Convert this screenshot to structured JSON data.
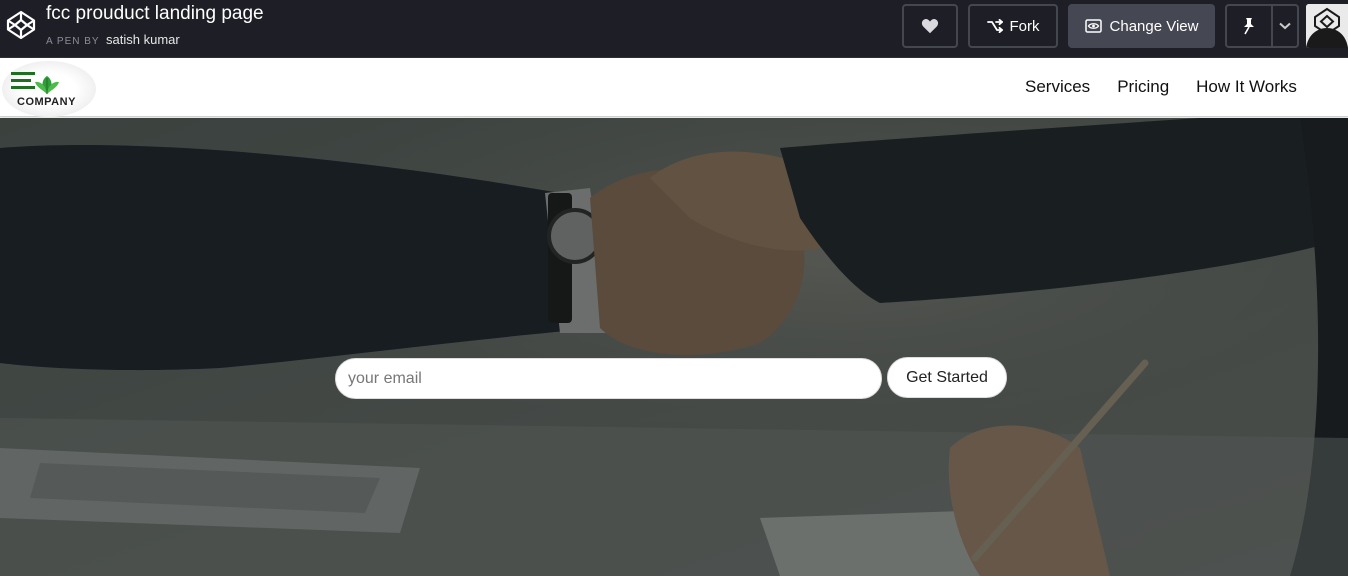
{
  "header": {
    "pen_title": "fcc prouduct landing page",
    "by_label": "A PEN BY",
    "author": "satish kumar",
    "fork_label": "Fork",
    "change_view_label": "Change View"
  },
  "icons": {
    "logo": "codepen-logo-icon",
    "heart": "heart-icon",
    "fork": "fork-icon",
    "view": "eye-icon",
    "pin": "pin-icon",
    "chevron": "chevron-down-icon"
  },
  "navbar": {
    "brand_text": "COMPANY",
    "links": [
      {
        "label": "Services"
      },
      {
        "label": "Pricing"
      },
      {
        "label": "How It Works"
      }
    ]
  },
  "hero": {
    "email_placeholder": "your email",
    "cta_label": "Get Started"
  },
  "colors": {
    "header_bg": "#1e1f26",
    "change_view_bg": "#454752",
    "brand_green": "#1f8a2a"
  }
}
